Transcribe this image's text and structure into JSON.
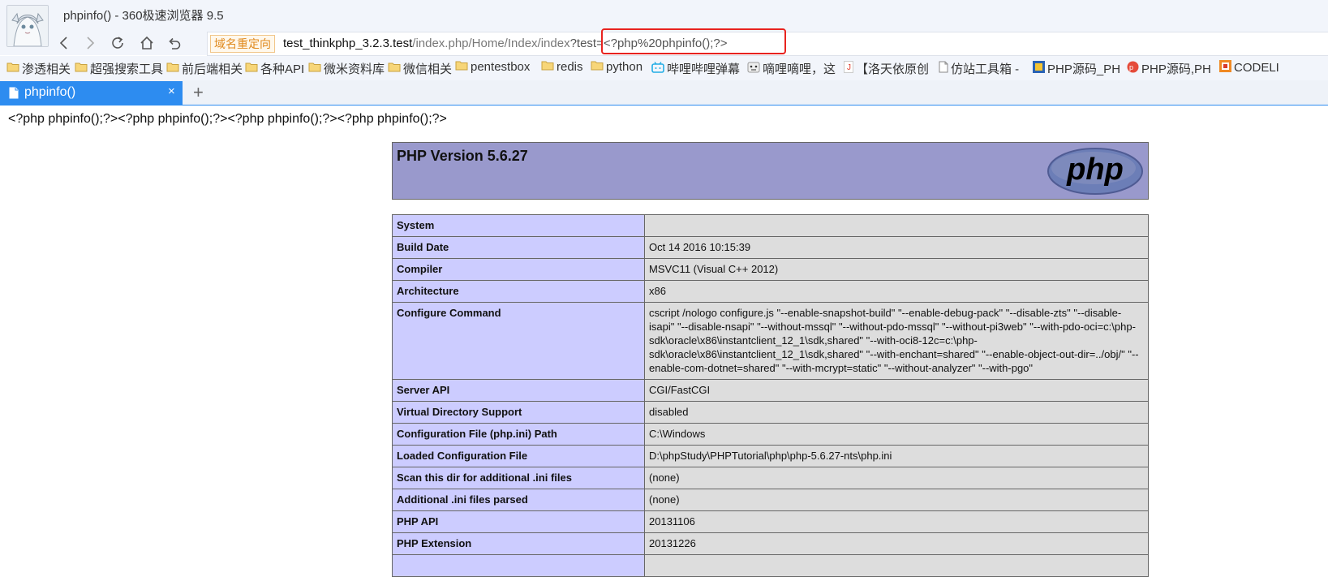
{
  "window": {
    "title": "phpinfo() - 360极速浏览器 9.5"
  },
  "address_bar": {
    "badge": "域名重定向",
    "host": "test_thinkphp_3.2.3.test",
    "path": "/index.php/Home/Index/index",
    "query": "?test=<?php%20phpinfo();?>"
  },
  "bookmarks": [
    {
      "label": "渗透相关",
      "icon": "folder-icon"
    },
    {
      "label": "超强搜索工具",
      "icon": "folder-icon"
    },
    {
      "label": "前后端相关",
      "icon": "folder-icon"
    },
    {
      "label": "各种API",
      "icon": "folder-icon"
    },
    {
      "label": "微米资料库",
      "icon": "folder-icon"
    },
    {
      "label": "微信相关",
      "icon": "folder-icon"
    },
    {
      "label": "pentestbox",
      "icon": "folder-icon"
    },
    {
      "label": "redis",
      "icon": "folder-icon"
    },
    {
      "label": "python",
      "icon": "folder-icon"
    },
    {
      "label": "哔哩哔哩弹幕",
      "icon": "bilibili-icon"
    },
    {
      "label": "嘀哩嘀哩，这",
      "icon": "face-icon"
    },
    {
      "label": "【洛天依原创",
      "icon": "j-icon"
    },
    {
      "label": "仿站工具箱 -",
      "icon": "page-icon"
    },
    {
      "label": "PHP源码_PH",
      "icon": "php-site-icon"
    },
    {
      "label": "PHP源码,PH",
      "icon": "php-red-icon"
    },
    {
      "label": "CODELI",
      "icon": "codeli-icon"
    }
  ],
  "tab": {
    "label": "phpinfo()",
    "close": "×",
    "new_tab": "+"
  },
  "page": {
    "echo": "<?php phpinfo();?><?php phpinfo();?><?php phpinfo();?><?php phpinfo();?>",
    "php_version": "PHP Version 5.6.27",
    "logo_text": "php",
    "rows": [
      {
        "key": "System",
        "value": ""
      },
      {
        "key": "Build Date",
        "value": "Oct 14 2016 10:15:39"
      },
      {
        "key": "Compiler",
        "value": "MSVC11 (Visual C++ 2012)"
      },
      {
        "key": "Architecture",
        "value": "x86"
      },
      {
        "key": "Configure Command",
        "value": "cscript /nologo configure.js \"--enable-snapshot-build\" \"--enable-debug-pack\" \"--disable-zts\" \"--disable-isapi\" \"--disable-nsapi\" \"--without-mssql\" \"--without-pdo-mssql\" \"--without-pi3web\" \"--with-pdo-oci=c:\\php-sdk\\oracle\\x86\\instantclient_12_1\\sdk,shared\" \"--with-oci8-12c=c:\\php-sdk\\oracle\\x86\\instantclient_12_1\\sdk,shared\" \"--with-enchant=shared\" \"--enable-object-out-dir=../obj/\" \"--enable-com-dotnet=shared\" \"--with-mcrypt=static\" \"--without-analyzer\" \"--with-pgo\""
      },
      {
        "key": "Server API",
        "value": "CGI/FastCGI"
      },
      {
        "key": "Virtual Directory Support",
        "value": "disabled"
      },
      {
        "key": "Configuration File (php.ini) Path",
        "value": "C:\\Windows"
      },
      {
        "key": "Loaded Configuration File",
        "value": "D:\\phpStudy\\PHPTutorial\\php\\php-5.6.27-nts\\php.ini"
      },
      {
        "key": "Scan this dir for additional .ini files",
        "value": "(none)"
      },
      {
        "key": "Additional .ini files parsed",
        "value": "(none)"
      },
      {
        "key": "PHP API",
        "value": "20131106"
      },
      {
        "key": "PHP Extension",
        "value": "20131226"
      },
      {
        "key": "",
        "value": ""
      }
    ]
  },
  "colors": {
    "tab_active": "#2d8cf0",
    "php_header": "#9999cc",
    "key_cell": "#ccccff",
    "value_cell": "#dddddd",
    "highlight": "#e8231f"
  }
}
